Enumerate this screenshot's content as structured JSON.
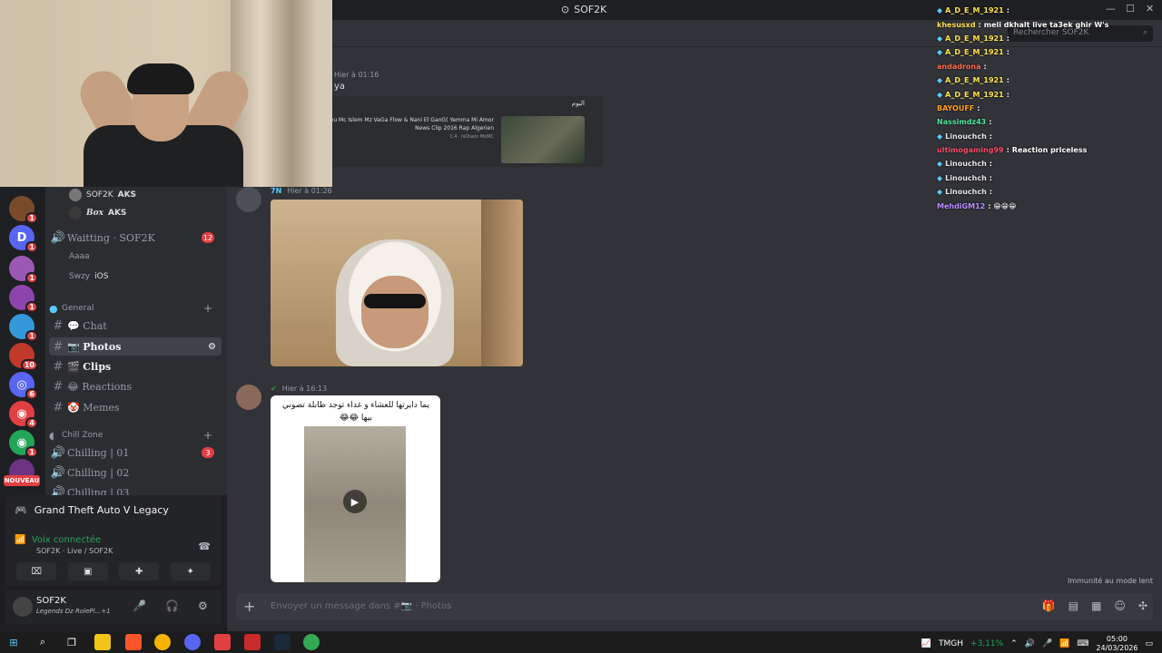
{
  "window": {
    "title": "SOF2K",
    "minimize": "—",
    "maximize": "☐",
    "close": "✕"
  },
  "search": {
    "placeholder": "Rechercher SOF2K"
  },
  "rail": {
    "servers": [
      {
        "label": "",
        "badge": "1",
        "color": "#7a4b2b"
      },
      {
        "label": "",
        "badge": "1",
        "color": "#5865f2"
      },
      {
        "label": "",
        "badge": "1",
        "color": "#9b59b6"
      },
      {
        "label": "",
        "badge": "1",
        "color": "#8e44ad"
      },
      {
        "label": "",
        "badge": "1",
        "color": "#3498db"
      },
      {
        "label": "",
        "badge": "10",
        "color": "#c0392b"
      },
      {
        "label": "",
        "badge": "6",
        "color": "#5865f2"
      },
      {
        "label": "",
        "badge": "4",
        "color": "#e23f43"
      },
      {
        "label": "",
        "badge": "1",
        "color": "#23a55a"
      },
      {
        "label": "",
        "badge": "",
        "color": "#6c3483"
      }
    ],
    "new_label": "NOUVEAU"
  },
  "channels": {
    "voice_users_top": [
      {
        "name": "SOF2K",
        "tag": "AKS"
      },
      {
        "name": "Box",
        "tag": "AKS"
      }
    ],
    "waiting": {
      "name": "Waitting · SOF2K",
      "count": "12"
    },
    "waiting_users": [
      {
        "name": "Aaaa",
        "tag": ""
      },
      {
        "name": "Swzy",
        "tag": "iOS"
      }
    ],
    "general_category": "General",
    "text_channels": [
      {
        "name": "Chat",
        "emoji": "💬"
      },
      {
        "name": "Photos",
        "emoji": "📷"
      },
      {
        "name": "Clips",
        "emoji": "🎬"
      },
      {
        "name": "Reactions",
        "emoji": "😂"
      },
      {
        "name": "Memes",
        "emoji": "🤡"
      }
    ],
    "chill_category": "Chill Zone",
    "voice_channels": [
      {
        "name": "Chilling | 01",
        "count": "3"
      },
      {
        "name": "Chilling | 02",
        "count": ""
      },
      {
        "name": "Chilling | 03",
        "count": ""
      }
    ]
  },
  "activity": {
    "game": "Grand Theft Auto V Legacy",
    "voice_status": "Voix connectée",
    "voice_sub": "SOF2K · Live / SOF2K"
  },
  "user": {
    "name": "SOF2K",
    "status": "Legends Dz RolePl...+1"
  },
  "messages": {
    "m1_time": "Hier à 01:16",
    "m1_text": "ya",
    "embed_header": "اليوم",
    "embed_title": "m Feu Mc  Islem Mz  VaGa Flow & Nani El GanG( Yemma Mi Amor News Clip 2016  Rap Algerien",
    "embed_meta": "1.4 · IsOhem MoMC",
    "m2_author": "",
    "m2_tag": "7N",
    "m2_time": "Hier à 01:26",
    "m3_author": "",
    "m3_time": "Hier à 16:13",
    "m3_caption": "يما دايرتها للعشاء و غداء توجد طابلة تصوني بيها 😂😂",
    "slowmode": "Immunité au mode lent"
  },
  "composer": {
    "placeholder": "Envoyer un message dans #📷 · Photos"
  },
  "overlay_chat": [
    {
      "user": "A_D_E_M_1921",
      "text": "",
      "color": "#ffe14d"
    },
    {
      "user": "khesusxd",
      "text": "meli dkhalt live ta3ek ghir W's",
      "color": "#ffe14d"
    },
    {
      "user": "A_D_E_M_1921",
      "text": "",
      "color": "#ffe14d"
    },
    {
      "user": "A_D_E_M_1921",
      "text": "",
      "color": "#ffe14d"
    },
    {
      "user": "andadrona",
      "text": "",
      "color": "#ff6a4d"
    },
    {
      "user": "A_D_E_M_1921",
      "text": "",
      "color": "#ffe14d"
    },
    {
      "user": "A_D_E_M_1921",
      "text": "",
      "color": "#ffe14d"
    },
    {
      "user": "BAYOUFF",
      "text": "",
      "color": "#ff9f1a"
    },
    {
      "user": "Nassimdz43",
      "text": "",
      "color": "#4de89a"
    },
    {
      "user": "Linouchch",
      "text": "",
      "color": "#e6e6e6"
    },
    {
      "user": "ultimogaming99",
      "text": "Reaction priceless",
      "color": "#ff4d6a"
    },
    {
      "user": "Linouchch",
      "text": "",
      "color": "#e6e6e6"
    },
    {
      "user": "Linouchch",
      "text": "",
      "color": "#e6e6e6"
    },
    {
      "user": "Linouchch",
      "text": "",
      "color": "#e6e6e6"
    },
    {
      "user": "MehdiGM12",
      "text": "😁😁😁",
      "color": "#b78cff"
    }
  ],
  "taskbar": {
    "ticker": "TMGH",
    "ticker_change": "+3,11%",
    "time": "05:00",
    "date": "24/03/2026"
  }
}
